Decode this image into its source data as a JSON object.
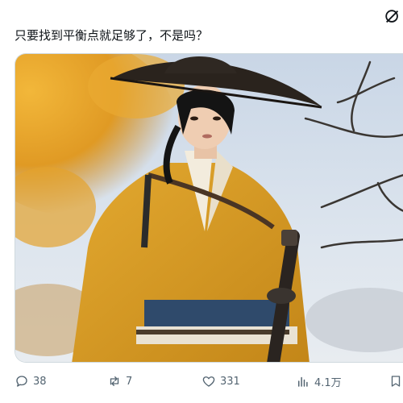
{
  "post": {
    "text": "只要找到平衡点就足够了，不是吗？"
  },
  "media": {
    "alt": "戴斗笠、身穿黄色和服、佩刀的女子站在秋日树下"
  },
  "actions": {
    "replies": "38",
    "reposts": "7",
    "likes": "331",
    "views": "4.1万"
  },
  "icons": {
    "reply": "reply-icon",
    "repost": "repost-icon",
    "like": "heart-icon",
    "views": "views-chart-icon",
    "bookmark": "bookmark-icon",
    "grok": "grok-icon"
  },
  "colors": {
    "text": "#0f1419",
    "muted": "#536471",
    "border": "#cfd9de"
  }
}
